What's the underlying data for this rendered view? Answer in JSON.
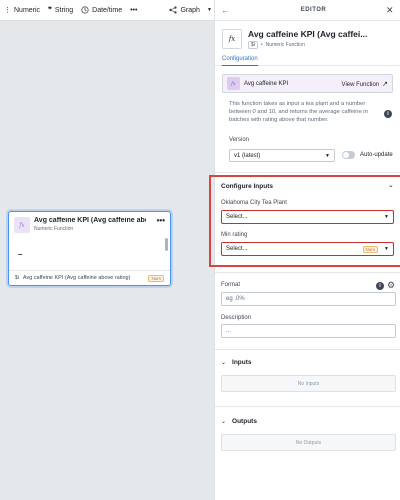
{
  "toolbar": {
    "numeric": "Numeric",
    "string": "String",
    "datetime": "Date/time",
    "more": "•••",
    "graph": "Graph"
  },
  "node": {
    "fx": "fx",
    "title": "Avg caffeine KPI (Avg caffeine above ...",
    "subtitle": "Numeric Function",
    "more": "•••",
    "value": "–",
    "footer_tag": "$i",
    "footer_label": "Avg caffeine KPI (Avg caffeine above rating)",
    "footer_badge": "Num"
  },
  "editor": {
    "header": "EDITOR",
    "back": "←",
    "close": "✕",
    "fx": "fx",
    "title": "Avg caffeine KPI (Avg caffei...",
    "meta_chip": "$i",
    "meta_type": "Numeric Function",
    "tab": "Configuration",
    "kpi_card_label": "Avg caffeine KPI",
    "view_function": "View Function",
    "description": "This function takes as input a tea plant and a number between 0 and 10, and returns the average caffeine in batches with rating above that number.",
    "version_label": "Version",
    "version_value": "v1 (latest)",
    "auto_update": "Auto-update",
    "configure_inputs": "Configure Inputs",
    "input1_label": "Oklahoma City Tea Plant",
    "input1_placeholder": "Select...",
    "input2_label": "Min rating",
    "input2_placeholder": "Select...",
    "input2_badge": "Num",
    "format_label": "Format",
    "format_placeholder": "eg .0%",
    "description_label": "Description",
    "description_placeholder": "...",
    "inputs_section": "Inputs",
    "no_inputs": "No Inputs",
    "outputs_section": "Outputs",
    "no_outputs": "No Outputs"
  },
  "colors": {
    "accent": "#2d72d2",
    "highlight_border": "#d64541",
    "node_border": "#4c90f0",
    "canvas_bg": "#e5e8eb"
  }
}
